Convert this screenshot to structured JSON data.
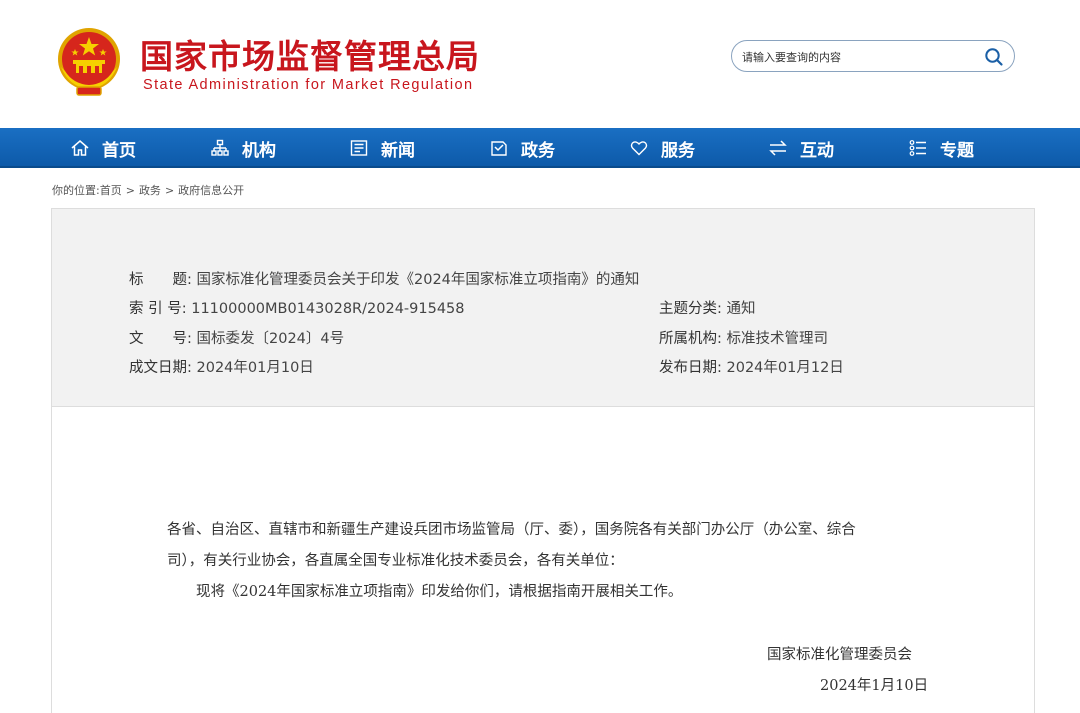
{
  "header": {
    "title": "国家市场监督管理总局",
    "subtitle": "State Administration for Market Regulation",
    "emblem": "national-emblem"
  },
  "search": {
    "placeholder": "请输入要查询的内容",
    "icon": "search-icon"
  },
  "nav": {
    "items": [
      {
        "label": "首页",
        "icon": "home-icon"
      },
      {
        "label": "机构",
        "icon": "org-icon"
      },
      {
        "label": "新闻",
        "icon": "news-icon"
      },
      {
        "label": "政务",
        "icon": "government-icon"
      },
      {
        "label": "服务",
        "icon": "heart-icon"
      },
      {
        "label": "互动",
        "icon": "exchange-icon"
      },
      {
        "label": "专题",
        "icon": "list-icon"
      }
    ]
  },
  "breadcrumb": {
    "prefix": "你的位置:",
    "items": [
      "首页",
      "政务",
      "政府信息公开"
    ],
    "separator": ">"
  },
  "info": {
    "title_label": "标　　题:",
    "title_value": "国家标准化管理委员会关于印发《2024年国家标准立项指南》的通知",
    "index_label": "索 引 号:",
    "index_value": "11100000MB0143028R/2024-915458",
    "topic_label": "主题分类:",
    "topic_value": "通知",
    "docno_label": "文　　号:",
    "docno_value": "国标委发〔2024〕4号",
    "org_label": "所属机构:",
    "org_value": "标准技术管理司",
    "written_label": "成文日期:",
    "written_value": "2024年01月10日",
    "published_label": "发布日期:",
    "published_value": "2024年01月12日"
  },
  "document": {
    "addressee_line1": "各省、自治区、直辖市和新疆生产建设兵团市场监管局（厅、委），国务院各有关部门办公厅（办公室、综合",
    "addressee_line2": "司），有关行业协会，各直属全国专业标准化技术委员会，各有关单位：",
    "body": "现将《2024年国家标准立项指南》印发给你们，请根据指南开展相关工作。",
    "signature": "国家标准化管理委员会",
    "date": "2024年1月10日"
  },
  "colors": {
    "brand_red": "#c8161d",
    "nav_blue": "#1565b8",
    "info_bg": "#f2f2f2"
  }
}
